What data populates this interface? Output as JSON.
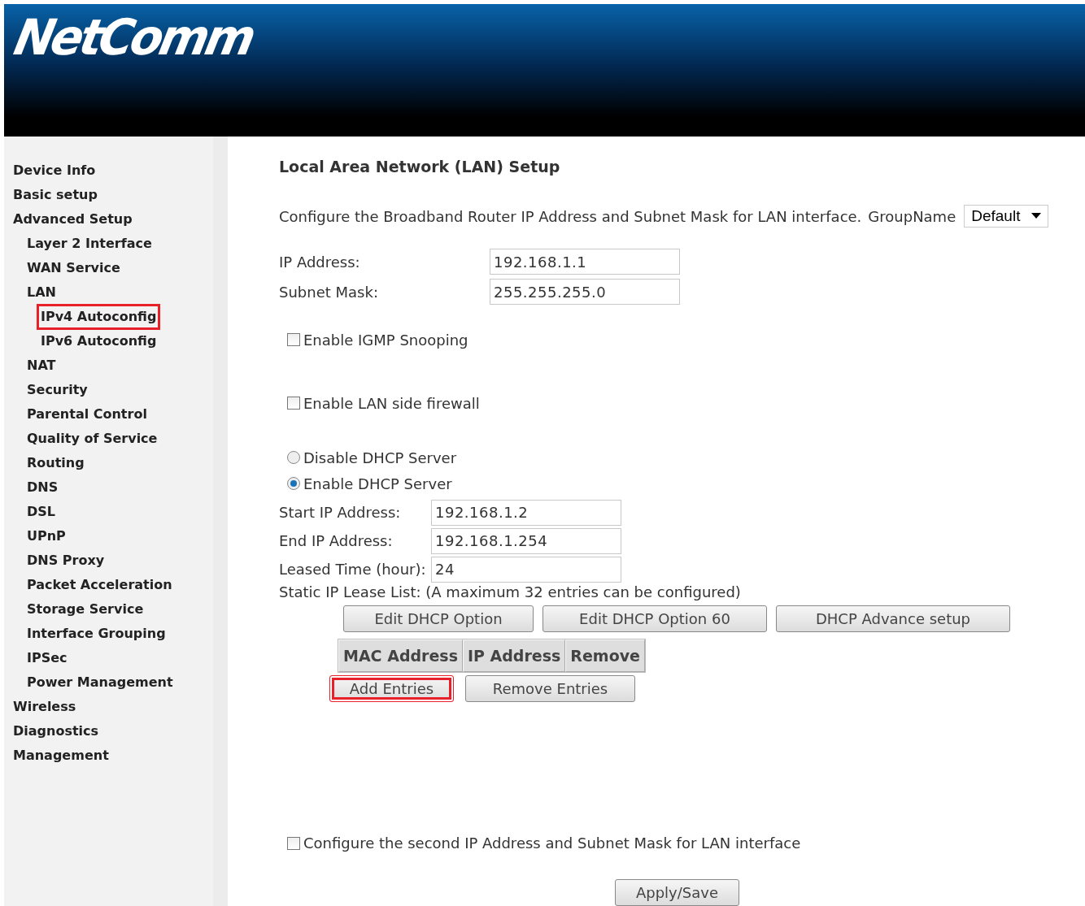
{
  "header": {
    "logo": "NetComm"
  },
  "sidebar": {
    "items": [
      {
        "label": "Device Info",
        "highlighted": false
      },
      {
        "label": "Basic setup",
        "highlighted": false
      },
      {
        "label": "Advanced Setup",
        "highlighted": false,
        "children": [
          {
            "label": "Layer 2 Interface",
            "highlighted": false
          },
          {
            "label": "WAN Service",
            "highlighted": false
          },
          {
            "label": "LAN",
            "highlighted": false,
            "children": [
              {
                "label": "IPv4 Autoconfig",
                "highlighted": true
              },
              {
                "label": "IPv6 Autoconfig",
                "highlighted": false
              }
            ]
          },
          {
            "label": "NAT",
            "highlighted": false
          },
          {
            "label": "Security",
            "highlighted": false
          },
          {
            "label": "Parental Control",
            "highlighted": false
          },
          {
            "label": "Quality of Service",
            "highlighted": false
          },
          {
            "label": "Routing",
            "highlighted": false
          },
          {
            "label": "DNS",
            "highlighted": false
          },
          {
            "label": "DSL",
            "highlighted": false
          },
          {
            "label": "UPnP",
            "highlighted": false
          },
          {
            "label": "DNS Proxy",
            "highlighted": false
          },
          {
            "label": "Packet Acceleration",
            "highlighted": false
          },
          {
            "label": "Storage Service",
            "highlighted": false
          },
          {
            "label": "Interface Grouping",
            "highlighted": false
          },
          {
            "label": "IPSec",
            "highlighted": false
          },
          {
            "label": "Power Management",
            "highlighted": false
          }
        ]
      },
      {
        "label": "Wireless",
        "highlighted": false
      },
      {
        "label": "Diagnostics",
        "highlighted": false
      },
      {
        "label": "Management",
        "highlighted": false
      }
    ]
  },
  "content": {
    "title": "Local Area Network (LAN) Setup",
    "description": "Configure the Broadband Router IP Address and Subnet Mask for LAN interface.",
    "group_name": {
      "label": "GroupName",
      "value": "Default"
    },
    "lan_fields": [
      {
        "label": "IP Address:",
        "value": "192.168.1.1"
      },
      {
        "label": "Subnet Mask:",
        "value": "255.255.255.0"
      }
    ],
    "options": [
      {
        "label": "Enable IGMP Snooping",
        "checked": false
      },
      {
        "label": "Enable LAN side firewall",
        "checked": false
      }
    ],
    "dhcp_modes": [
      {
        "label": "Disable DHCP Server",
        "selected": false
      },
      {
        "label": "Enable DHCP Server",
        "selected": true
      }
    ],
    "dhcp_fields": [
      {
        "label": "Start IP Address:",
        "value": "192.168.1.2"
      },
      {
        "label": "End IP Address:",
        "value": "192.168.1.254"
      },
      {
        "label": "Leased Time (hour):",
        "value": "24"
      }
    ],
    "static_lease_note": "Static IP Lease List: (A maximum 32 entries can be configured)",
    "option_buttons": [
      {
        "label": "Edit DHCP Option"
      },
      {
        "label": "Edit DHCP Option 60"
      },
      {
        "label": "DHCP Advance setup"
      }
    ],
    "lease_table": {
      "columns": [
        "MAC Address",
        "IP Address",
        "Remove"
      ]
    },
    "entry_buttons": [
      {
        "label": "Add Entries",
        "highlighted": true
      },
      {
        "label": "Remove Entries",
        "highlighted": false
      }
    ],
    "second_ip": {
      "label": "Configure the second IP Address and Subnet Mask for LAN interface",
      "checked": false
    },
    "apply_button": {
      "label": "Apply/Save"
    }
  }
}
